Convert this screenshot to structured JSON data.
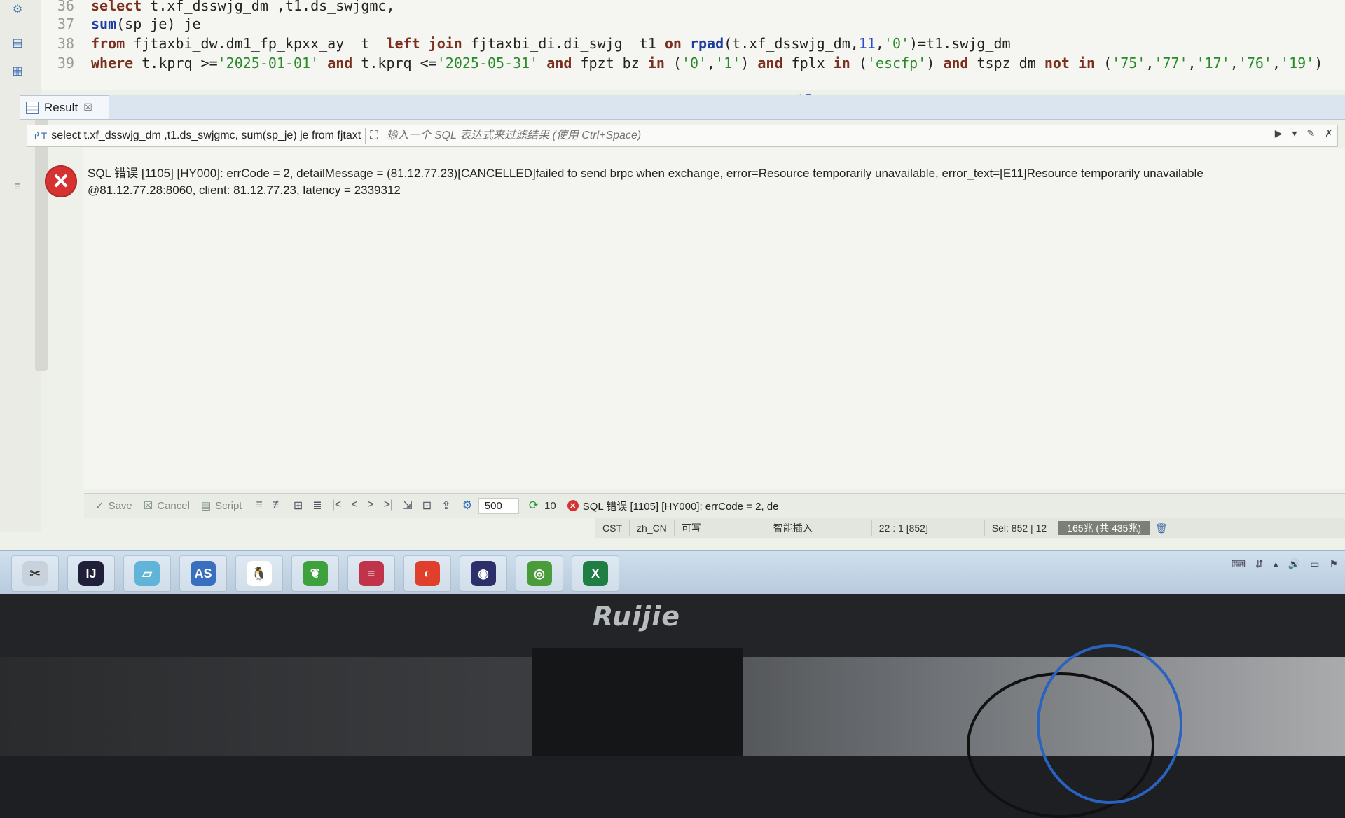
{
  "editor": {
    "lines": [
      {
        "num": "36",
        "parts": [
          [
            "kw",
            "select"
          ],
          [
            "txt",
            " t.xf_dsswjg_dm ,t1.ds_swjgmc,"
          ]
        ]
      },
      {
        "num": "37",
        "parts": [
          [
            "fn",
            "sum"
          ],
          [
            "txt",
            "(sp_je) je"
          ]
        ]
      },
      {
        "num": "38",
        "parts": [
          [
            "kw",
            "from"
          ],
          [
            "txt",
            " fjtaxbi_dw.dm1_fp_kpxx_ay  t  "
          ],
          [
            "kw",
            "left join"
          ],
          [
            "txt",
            " fjtaxbi_di.di_swjg  t1 "
          ],
          [
            "kw",
            "on"
          ],
          [
            "txt",
            " "
          ],
          [
            "fn",
            "rpad"
          ],
          [
            "txt",
            "(t.xf_dsswjg_dm,"
          ],
          [
            "num",
            "11"
          ],
          [
            "txt",
            ","
          ],
          [
            "str",
            "'0'"
          ],
          [
            "txt",
            ")=t1.swjg_dm"
          ]
        ]
      },
      {
        "num": "39",
        "parts": [
          [
            "kw",
            "where"
          ],
          [
            "txt",
            " t.kprq >="
          ],
          [
            "str",
            "'2025-01-01'"
          ],
          [
            "txt",
            " "
          ],
          [
            "kw",
            "and"
          ],
          [
            "txt",
            " t.kprq <="
          ],
          [
            "str",
            "'2025-05-31'"
          ],
          [
            "txt",
            " "
          ],
          [
            "kw",
            "and"
          ],
          [
            "txt",
            " fpzt_bz "
          ],
          [
            "kw",
            "in"
          ],
          [
            "txt",
            " ("
          ],
          [
            "str",
            "'0'"
          ],
          [
            "txt",
            ","
          ],
          [
            "str",
            "'1'"
          ],
          [
            "txt",
            ") "
          ],
          [
            "kw",
            "and"
          ],
          [
            "txt",
            " fplx "
          ],
          [
            "kw",
            "in"
          ],
          [
            "txt",
            " ("
          ],
          [
            "str",
            "'escfp'"
          ],
          [
            "txt",
            ") "
          ],
          [
            "kw",
            "and"
          ],
          [
            "txt",
            " tspz_dm "
          ],
          [
            "kw",
            "not in"
          ],
          [
            "txt",
            " ("
          ],
          [
            "str",
            "'75'"
          ],
          [
            "txt",
            ","
          ],
          [
            "str",
            "'77'"
          ],
          [
            "txt",
            ","
          ],
          [
            "str",
            "'17'"
          ],
          [
            "txt",
            ","
          ],
          [
            "str",
            "'76'"
          ],
          [
            "txt",
            ","
          ],
          [
            "str",
            "'19'"
          ],
          [
            "txt",
            ")"
          ]
        ]
      }
    ]
  },
  "result_tab": {
    "label": "Result",
    "close": "☒"
  },
  "filter": {
    "query_text": "select t.xf_dsswjg_dm ,t1.ds_swjgmc, sum(sp_je) je from fjtaxt",
    "placeholder": "输入一个 SQL 表达式来过滤结果 (使用 Ctrl+Space)"
  },
  "error": {
    "line1": "SQL 错误 [1105] [HY000]: errCode = 2, detailMessage = (81.12.77.23)[CANCELLED]failed to send brpc when exchange, error=Resource temporarily unavailable, error_text=[E11]Resource temporarily unavailable",
    "line2": "@81.12.77.28:8060, client: 81.12.77.23, latency = 2339312"
  },
  "toolbar": {
    "save_label": "Save",
    "cancel_label": "Cancel",
    "script_label": "Script",
    "fetch_size": "500",
    "row_count": "10",
    "status_error": "SQL 错误 [1105] [HY000]: errCode = 2, de"
  },
  "statusbar": {
    "timezone": "CST",
    "locale": "zh_CN",
    "mode": "可写",
    "insert_mode": "智能插入",
    "position": "22 : 1 [852]",
    "selection": "Sel: 852 | 12",
    "memory": "165兆 (共 435兆)"
  },
  "taskbar": {
    "apps": [
      {
        "name": "scissors-app",
        "color": "#c8d2dc",
        "glyph": "✂"
      },
      {
        "name": "intellij-app",
        "color": "#1f1f3a",
        "glyph": "IJ"
      },
      {
        "name": "files-app",
        "color": "#5fb4d8",
        "glyph": "▱"
      },
      {
        "name": "studio-app",
        "color": "#3a6fc0",
        "glyph": "AS"
      },
      {
        "name": "navicat-app",
        "color": "#ffffff",
        "glyph": "🐧"
      },
      {
        "name": "leaf-app",
        "color": "#3da23d",
        "glyph": "❦"
      },
      {
        "name": "database-app",
        "color": "#c0334a",
        "glyph": "≡"
      },
      {
        "name": "swift-app",
        "color": "#e0402b",
        "glyph": "◐"
      },
      {
        "name": "eclipse-app",
        "color": "#2c2f6a",
        "glyph": "◉"
      },
      {
        "name": "wechat-work-app",
        "color": "#4a9c3a",
        "glyph": "◎"
      },
      {
        "name": "excel-app",
        "color": "#1e7e43",
        "glyph": "X"
      }
    ]
  },
  "brand": "Ruijie"
}
